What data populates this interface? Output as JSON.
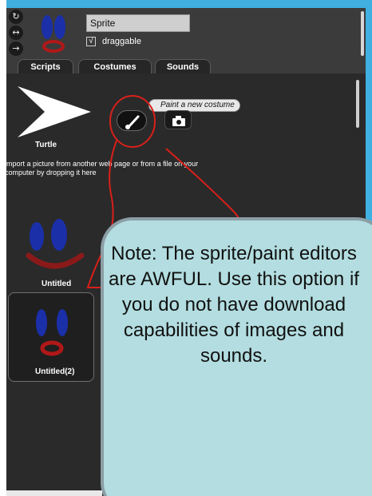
{
  "sprite": {
    "name": "Sprite",
    "draggable_label": "draggable",
    "draggable_checked": true
  },
  "rotation_controls": [
    {
      "icon": "rotate-icon",
      "glyph": "↻"
    },
    {
      "icon": "left-right-icon",
      "glyph": "↔"
    },
    {
      "icon": "no-rotate-icon",
      "glyph": "→"
    }
  ],
  "tabs": [
    {
      "label": "Scripts"
    },
    {
      "label": "Costumes",
      "active": true
    },
    {
      "label": "Sounds"
    }
  ],
  "wardrobe": {
    "turtle_label": "Turtle",
    "paint_tooltip": "Paint a new costume",
    "import_hint": "import a picture from another web page or from a file on your computer by dropping it here",
    "costumes": [
      {
        "name": "Untitled"
      },
      {
        "name": "Untitled(2)"
      }
    ]
  },
  "note": {
    "text": "Note: The sprite/paint editors are AWFUL. Use this option if you do not have download capabilities of images and sounds."
  },
  "colors": {
    "accent_blue": "#3fb0df",
    "annotation_red": "#d8201a",
    "note_fill": "#b3dde0",
    "editor_bg": "#2a2a2a"
  }
}
